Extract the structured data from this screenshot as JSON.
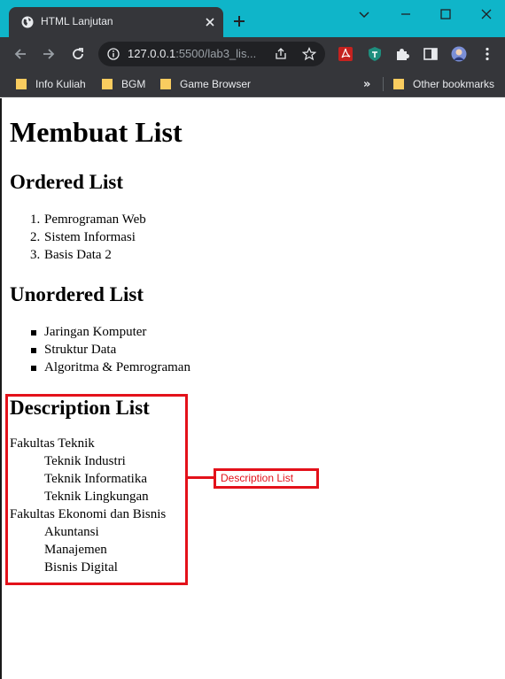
{
  "browser": {
    "tab_title": "HTML Lanjutan",
    "url_host": "127.0.0.1",
    "url_rest": ":5500/lab3_lis...",
    "bookmarks": [
      "Info Kuliah",
      "BGM",
      "Game Browser"
    ],
    "other_bookmarks": "Other bookmarks"
  },
  "page": {
    "title": "Membuat List",
    "ordered": {
      "heading": "Ordered List",
      "markers": [
        "1.",
        "2.",
        "3."
      ],
      "items": [
        "Pemrograman Web",
        "Sistem Informasi",
        "Basis Data 2"
      ]
    },
    "unordered": {
      "heading": "Unordered List",
      "items": [
        "Jaringan Komputer",
        "Struktur Data",
        "Algoritma & Pemrograman"
      ]
    },
    "description": {
      "heading": "Description List",
      "groups": [
        {
          "term": "Fakultas Teknik",
          "defs": [
            "Teknik Industri",
            "Teknik Informatika",
            "Teknik Lingkungan"
          ]
        },
        {
          "term": "Fakultas Ekonomi dan Bisnis",
          "defs": [
            "Akuntansi",
            "Manajemen",
            "Bisnis Digital"
          ]
        }
      ]
    }
  },
  "annotation": {
    "label": "Description List",
    "color": "#e3111a"
  },
  "colors": {
    "titlebar": "#0fb5c9",
    "chrome_dark": "#35363a",
    "omnibox": "#202124"
  }
}
